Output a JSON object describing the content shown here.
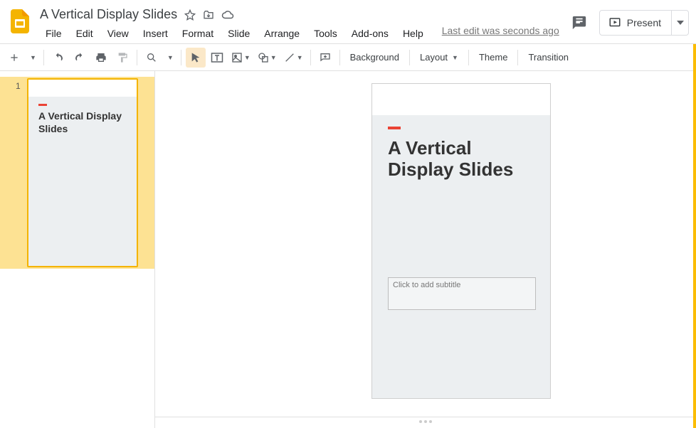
{
  "header": {
    "doc_title": "A Vertical Display Slides",
    "last_edit": "Last edit was seconds ago",
    "present_label": "Present"
  },
  "menus": [
    "File",
    "Edit",
    "View",
    "Insert",
    "Format",
    "Slide",
    "Arrange",
    "Tools",
    "Add-ons",
    "Help"
  ],
  "toolbar": {
    "background": "Background",
    "layout": "Layout",
    "theme": "Theme",
    "transition": "Transition"
  },
  "filmstrip": {
    "slides": [
      {
        "number": "1",
        "title": "A Vertical Display Slides"
      }
    ]
  },
  "canvas": {
    "title": "A Vertical Display Slides",
    "subtitle_placeholder": "Click to add subtitle"
  }
}
